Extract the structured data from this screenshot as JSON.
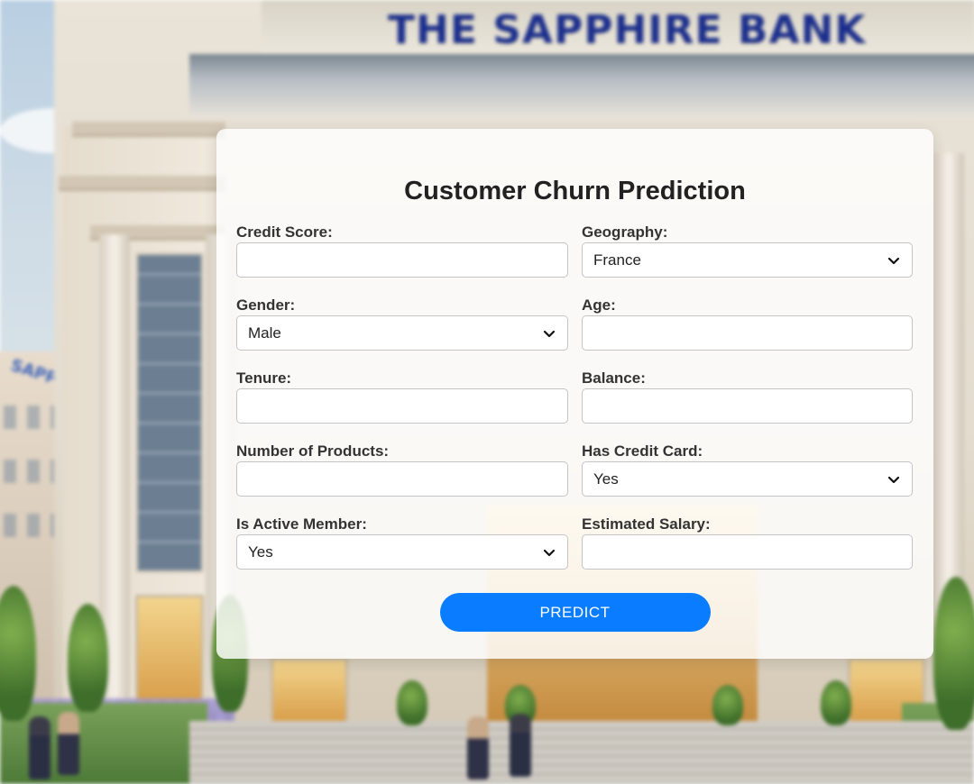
{
  "background": {
    "sign_text": "THE SAPPHIRE BANK",
    "side_sign_text": "SAPPHIRE"
  },
  "form": {
    "title": "Customer Churn Prediction",
    "fields": {
      "credit_score": {
        "label": "Credit Score:",
        "value": ""
      },
      "geography": {
        "label": "Geography:",
        "value": "France"
      },
      "gender": {
        "label": "Gender:",
        "value": "Male"
      },
      "age": {
        "label": "Age:",
        "value": ""
      },
      "tenure": {
        "label": "Tenure:",
        "value": ""
      },
      "balance": {
        "label": "Balance:",
        "value": ""
      },
      "num_products": {
        "label": "Number of Products:",
        "value": ""
      },
      "has_credit_card": {
        "label": "Has Credit Card:",
        "value": "Yes"
      },
      "is_active_member": {
        "label": "Is Active Member:",
        "value": "Yes"
      },
      "estimated_salary": {
        "label": "Estimated Salary:",
        "value": ""
      }
    },
    "submit_label": "PREDICT"
  },
  "colors": {
    "accent": "#0a7cff",
    "card_background": "#ffffffd1",
    "sign_text": "#1b2e8c"
  },
  "icons": {
    "select_chevron": "chevron-down-icon"
  }
}
